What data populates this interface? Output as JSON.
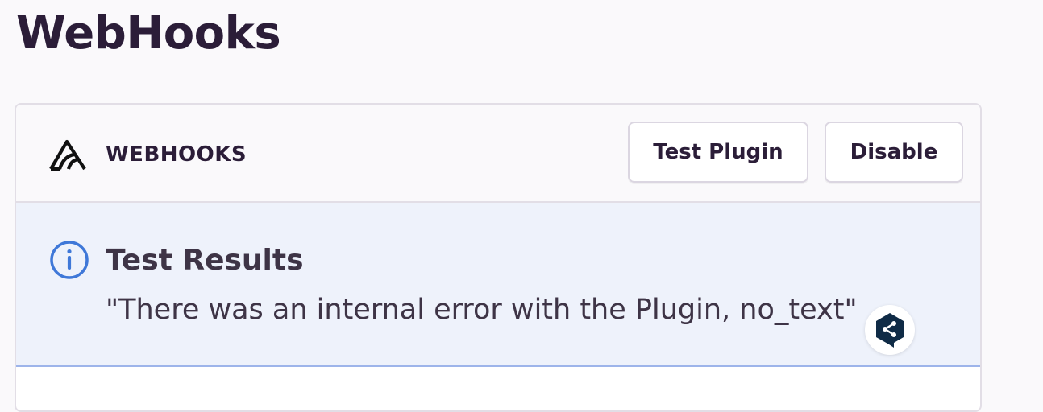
{
  "page": {
    "title": "WebHooks"
  },
  "plugin": {
    "name": "WEBHOOKS",
    "icon": "sentry-logo-icon"
  },
  "actions": {
    "test_label": "Test Plugin",
    "disable_label": "Disable"
  },
  "alert": {
    "icon": "info-icon",
    "title": "Test Results",
    "message": "\"There was an internal error with the Plugin, no_text\"",
    "color": "#eef2fb",
    "accent": "#3f78d8"
  },
  "overlay": {
    "icon": "deepl-icon"
  }
}
